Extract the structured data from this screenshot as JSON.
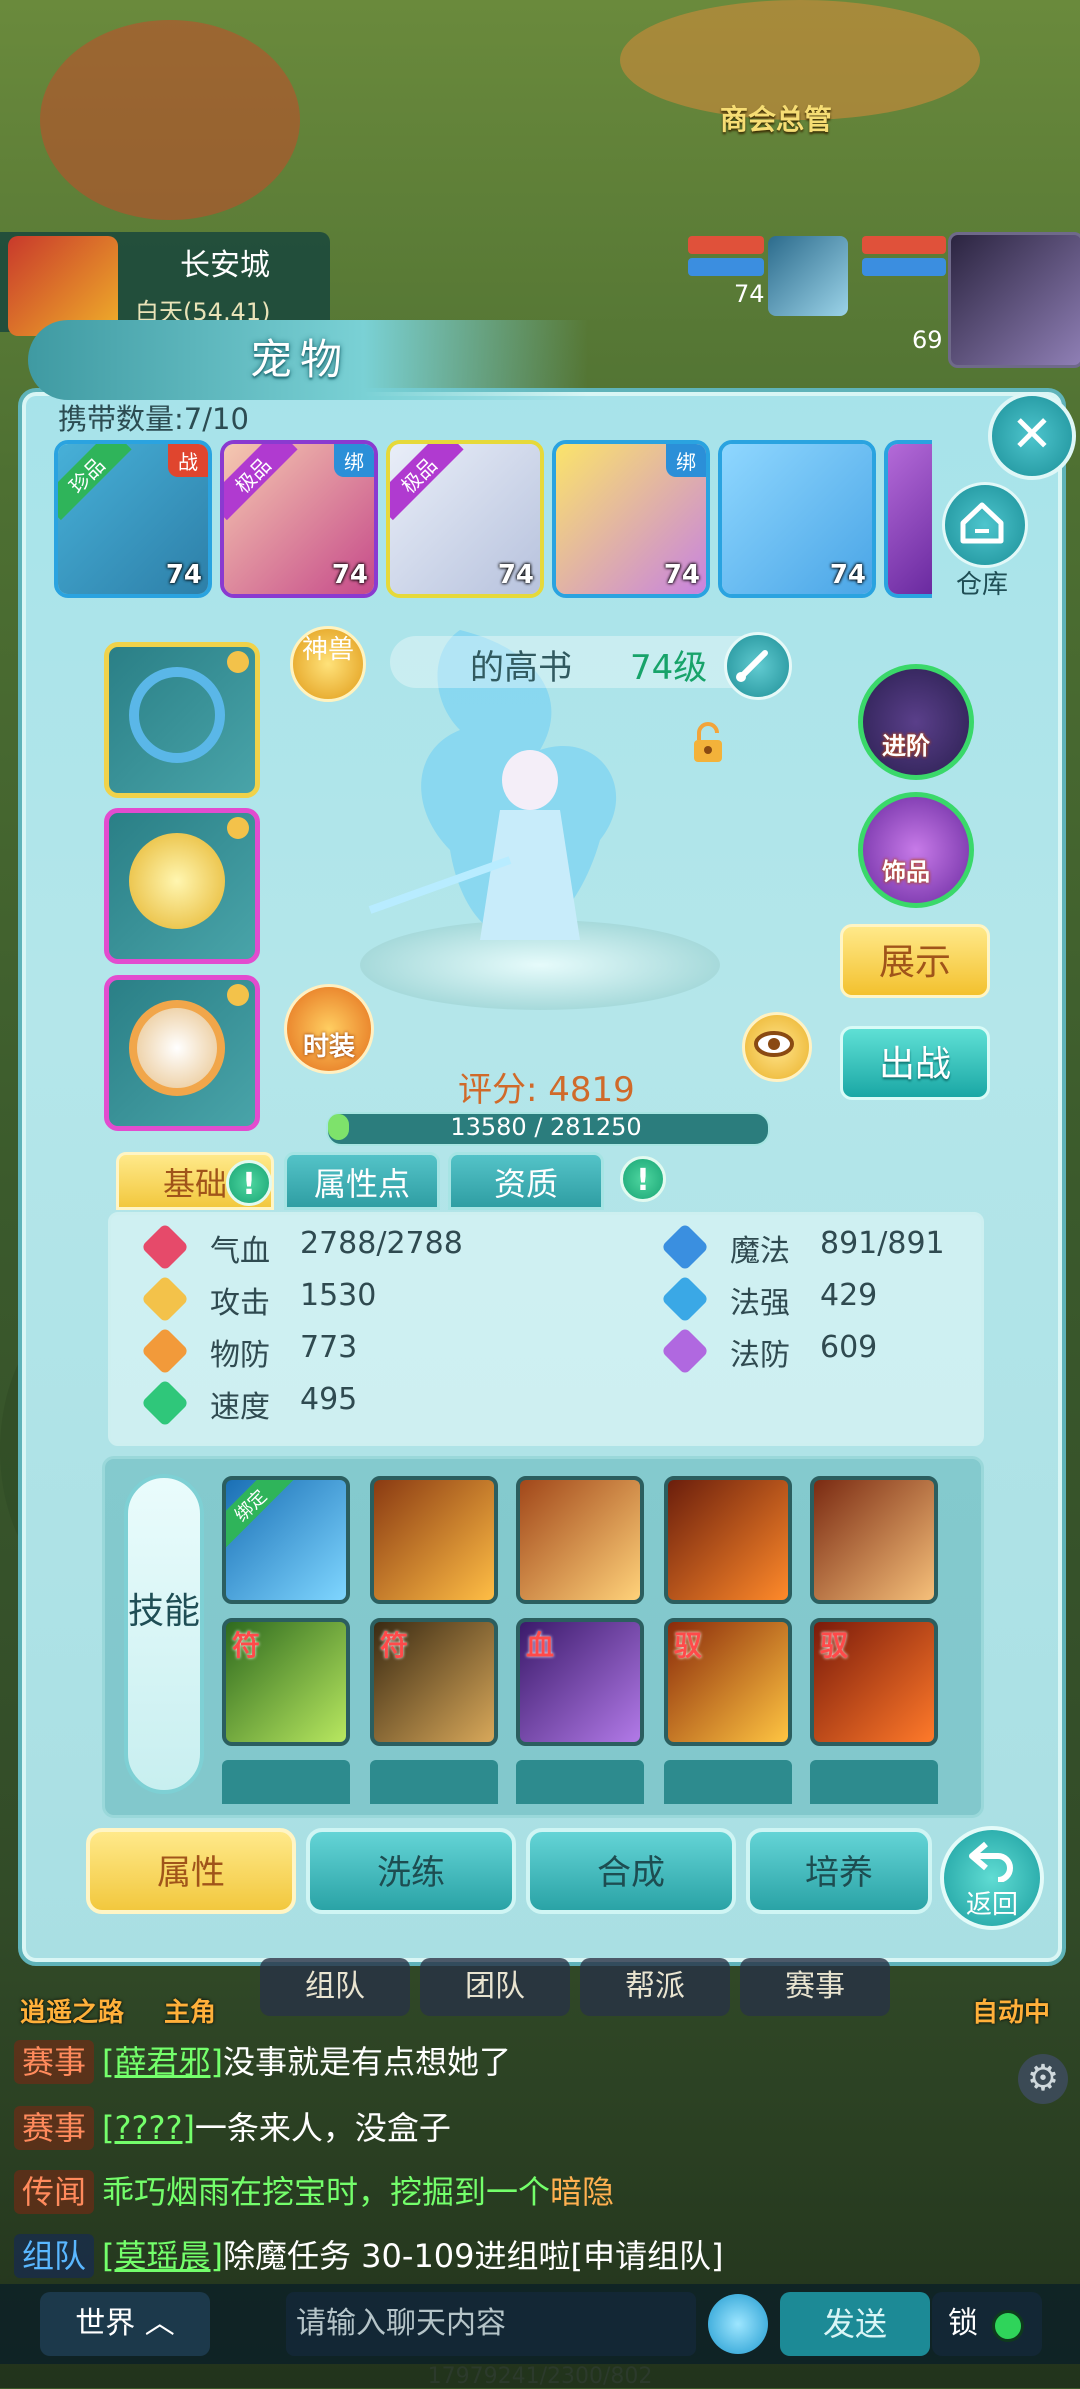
{
  "scene": {
    "npc_label": "商会总管",
    "city_name": "长安城",
    "city_sub": "白天(54,41)",
    "party_levels": [
      "74",
      "69"
    ]
  },
  "panel": {
    "title": "宠物",
    "close_label": "✕",
    "carry_label": "携带数量:7/10",
    "storage_label": "仓库",
    "pets": [
      {
        "rank": "珍品",
        "tag": "战",
        "level": "74",
        "colors": [
          "#47b0d8",
          "#2d7fa8"
        ]
      },
      {
        "rank": "极品",
        "tag": "绑",
        "level": "74",
        "colors": [
          "#f5c9b0",
          "#c64a8a"
        ]
      },
      {
        "rank": "极品",
        "tag": "",
        "level": "74",
        "colors": [
          "#e9eef8",
          "#b7c2dd"
        ]
      },
      {
        "rank": "",
        "tag": "绑",
        "level": "74",
        "colors": [
          "#fbe46a",
          "#c782e0"
        ]
      },
      {
        "rank": "",
        "tag": "",
        "level": "74",
        "colors": [
          "#8fd7ff",
          "#4aa5e6"
        ]
      }
    ],
    "pet_name": "的高书",
    "pet_level": "74级",
    "shenshou_label": "神兽",
    "jinjie_label": "进阶",
    "shipin_label": "饰品",
    "show_label": "展示",
    "battle_label": "出战",
    "fashion_label": "时装",
    "score_label": "评分: 4819",
    "exp_text": "13580 / 281250",
    "exp_fraction": 0.048,
    "tabs": [
      "基础",
      "属性点",
      "资质"
    ],
    "warn_mark": "!",
    "stats_left": [
      {
        "label": "气血",
        "value": "2788/2788",
        "color": "#e64a6a"
      },
      {
        "label": "攻击",
        "value": "1530",
        "color": "#f3c24a"
      },
      {
        "label": "物防",
        "value": "773",
        "color": "#f29a3a"
      },
      {
        "label": "速度",
        "value": "495",
        "color": "#2fc77a"
      }
    ],
    "stats_right": [
      {
        "label": "魔法",
        "value": "891/891",
        "color": "#3a8fe0"
      },
      {
        "label": "法强",
        "value": "429",
        "color": "#3aa8e6"
      },
      {
        "label": "法防",
        "value": "609",
        "color": "#b068e0"
      }
    ],
    "skills_title": "技能",
    "skills_row1": [
      {
        "badge": "绑定",
        "colors": [
          "#1a6fb5",
          "#7fd6ff"
        ]
      },
      {
        "badge": "",
        "colors": [
          "#8a3a12",
          "#ffbe45"
        ]
      },
      {
        "badge": "",
        "colors": [
          "#a1471a",
          "#ffd27a"
        ]
      },
      {
        "badge": "",
        "colors": [
          "#6b1e0c",
          "#ff8a2a"
        ]
      },
      {
        "badge": "",
        "colors": [
          "#7a2a12",
          "#f6c07a"
        ]
      }
    ],
    "skills_row2": [
      {
        "badge": "符",
        "colors": [
          "#2e6a1e",
          "#b8e860"
        ]
      },
      {
        "badge": "符",
        "colors": [
          "#3a2a12",
          "#d8a85a"
        ]
      },
      {
        "badge": "血",
        "colors": [
          "#3a1a6a",
          "#b27ae8"
        ]
      },
      {
        "badge": "驭",
        "colors": [
          "#8a2a0a",
          "#ffc542"
        ]
      },
      {
        "badge": "驭",
        "colors": [
          "#7a1a0a",
          "#ff7a2a"
        ]
      }
    ],
    "bottom_buttons": [
      "属性",
      "洗练",
      "合成",
      "培养"
    ],
    "back_label": "返回"
  },
  "chat": {
    "tabs": [
      "组队",
      "团队",
      "帮派",
      "赛事"
    ],
    "side_left": [
      "逍遥之路",
      "主角"
    ],
    "side_right": "自动中",
    "lines": [
      {
        "tag": "赛事",
        "name": "[薛君邪]",
        "text": "没事就是有点想她了",
        "hl": ""
      },
      {
        "tag": "赛事",
        "name": "[????]",
        "text": "一条来人，没盒子",
        "hl": ""
      },
      {
        "tag": "传闻",
        "name": "",
        "text": "乖巧烟雨在挖宝时，挖掘到一个",
        "hl": "暗隐"
      },
      {
        "tag": "组队",
        "name": "[莫瑶晨]",
        "text": "除魔任务 30-109进组啦[申请组队]",
        "hl": ""
      }
    ],
    "channel": "世界",
    "input_placeholder": "请输入聊天内容",
    "send_label": "发送",
    "lock_label": "锁",
    "footer": "17979241/2300/802"
  }
}
